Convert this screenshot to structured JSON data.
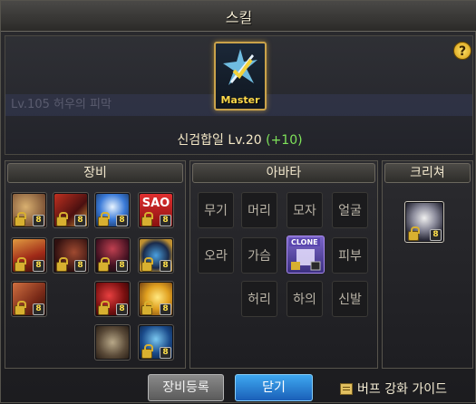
{
  "window": {
    "title": "스킬"
  },
  "skill": {
    "badge": "Master",
    "name_level": "신검합일 Lv.20",
    "bonus": "(+10)",
    "background_text": "Lv.105 허우의 피막"
  },
  "help": {
    "icon_label": "?"
  },
  "equipment": {
    "title": "장비",
    "slots": [
      {
        "badge": "8"
      },
      {
        "badge": "8"
      },
      {
        "badge": "8"
      },
      {
        "badge": "8",
        "text": "SAO"
      },
      {
        "badge": "8"
      },
      {
        "badge": "8"
      },
      {
        "badge": "8"
      },
      {
        "badge": "8"
      },
      {
        "badge": "8"
      },
      {
        "badge": "8"
      },
      {
        "badge": "8"
      },
      {
        "badge": ""
      },
      {
        "badge": "8"
      }
    ]
  },
  "avatar": {
    "title": "아바타",
    "slots": [
      "무기",
      "머리",
      "모자",
      "얼굴",
      "오라",
      "가슴",
      "피부",
      "허리",
      "하의",
      "신발"
    ],
    "equipped_label": "CLONE"
  },
  "creature": {
    "title": "크리쳐"
  },
  "buttons": {
    "register": "장비등록",
    "close": "닫기"
  },
  "guide": {
    "label": "버프 강화 가이드"
  }
}
